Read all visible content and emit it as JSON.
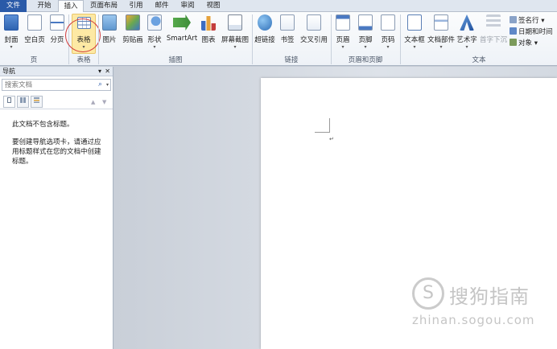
{
  "tabs": [
    {
      "label": "文件",
      "style": "file"
    },
    {
      "label": "开始",
      "style": ""
    },
    {
      "label": "插入",
      "style": "active"
    },
    {
      "label": "页面布局",
      "style": ""
    },
    {
      "label": "引用",
      "style": ""
    },
    {
      "label": "邮件",
      "style": ""
    },
    {
      "label": "审阅",
      "style": ""
    },
    {
      "label": "视图",
      "style": ""
    }
  ],
  "ribbon": {
    "groups": {
      "pages": "页",
      "tables": "表格",
      "illustrations": "插图",
      "links": "链接",
      "header_footer": "页眉和页脚",
      "text": "文本"
    },
    "buttons": {
      "cover": "封面",
      "blank_page": "空白页",
      "page_break": "分页",
      "table": "表格",
      "picture": "图片",
      "clip_art": "剪贴画",
      "shapes": "形状",
      "smartart": "SmartArt",
      "chart": "图表",
      "screenshot": "屏幕截图",
      "hyperlink": "超链接",
      "bookmark": "书签",
      "cross_ref": "交叉引用",
      "header": "页眉",
      "footer": "页脚",
      "page_number": "页码",
      "text_box": "文本框",
      "quick_parts": "文档部件",
      "wordart": "艺术字",
      "drop_cap": "首字下沉",
      "signature_line": "签名行",
      "date_time": "日期和时间",
      "object": "对象"
    },
    "dropdown_glyph": "▾"
  },
  "nav": {
    "title": "导航",
    "pin_glyph": "▾",
    "close_glyph": "✕",
    "search_placeholder": "搜索文档",
    "search_icon": "⌕",
    "msg1": "此文档不包含标题。",
    "msg2": "要创建导航选项卡，请通过应用标题样式在您的文档中创建标题。",
    "up_glyph": "▲",
    "down_glyph": "▼"
  },
  "document": {
    "paragraph_mark": "↵"
  },
  "watermark": {
    "logo": "S",
    "name": "搜狗指南",
    "url": "zhinan.sogou.com"
  },
  "colors": {
    "file_tab": "#2a5aa8",
    "highlight": "#fde9a4",
    "annotation_circle": "#d23b3b"
  }
}
